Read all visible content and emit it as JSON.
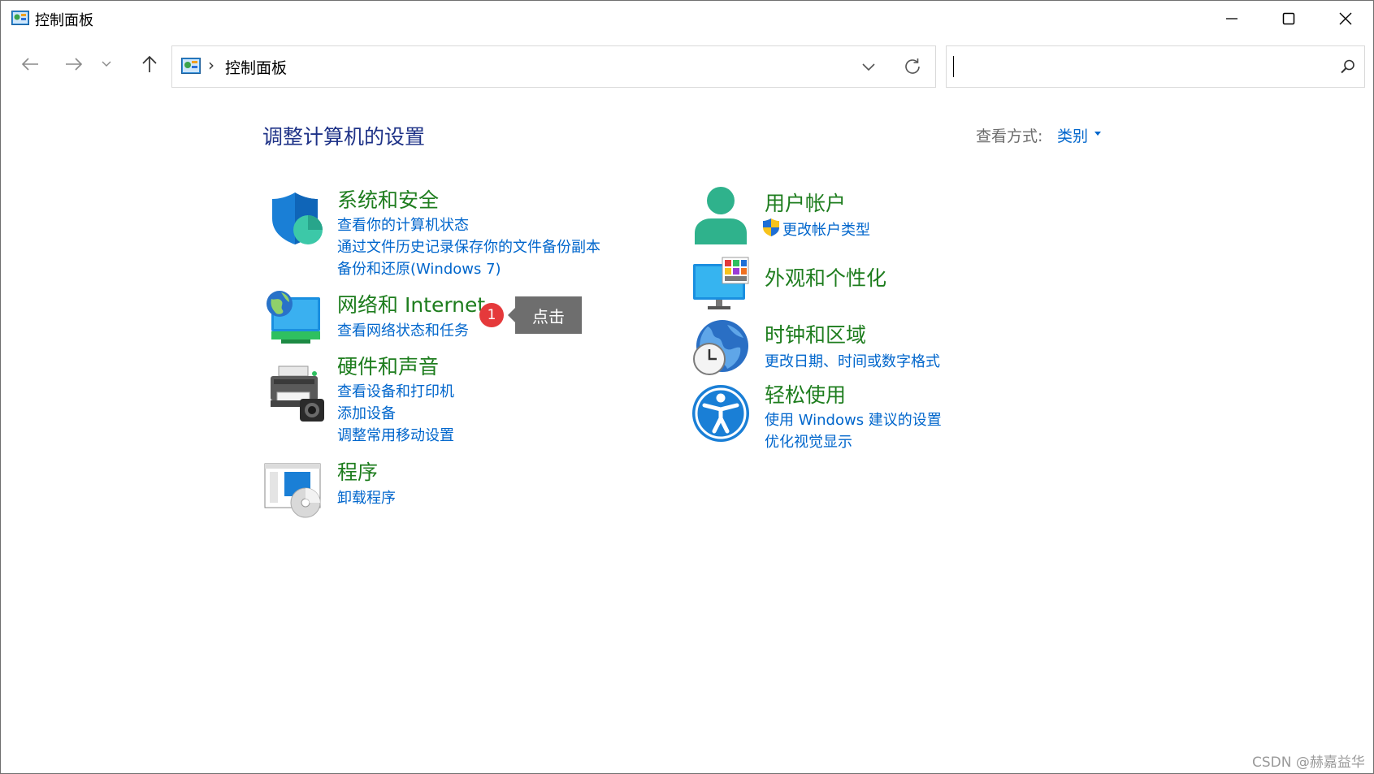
{
  "window": {
    "title": "控制面板",
    "minimize_icon": "minimize-icon",
    "maximize_icon": "maximize-icon",
    "close_icon": "close-icon"
  },
  "nav": {
    "back_icon": "arrow-left-icon",
    "forward_icon": "arrow-right-icon",
    "recent_icon": "chevron-down-icon",
    "up_icon": "arrow-up-icon"
  },
  "address": {
    "separator": "›",
    "path": "控制面板",
    "dropdown_icon": "chevron-down-icon",
    "refresh_icon": "refresh-icon"
  },
  "search": {
    "value": "",
    "icon": "search-icon"
  },
  "main": {
    "title": "调整计算机的设置",
    "view_label": "查看方式:",
    "view_value": "类别"
  },
  "categories": [
    {
      "title": "系统和安全",
      "icon": "shield-icon",
      "links": [
        "查看你的计算机状态",
        "通过文件历史记录保存你的文件备份副本",
        "备份和还原(Windows 7)"
      ]
    },
    {
      "title": "网络和 Internet",
      "icon": "network-globe-icon",
      "links": [
        "查看网络状态和任务"
      ]
    },
    {
      "title": "硬件和声音",
      "icon": "printer-icon",
      "links": [
        "查看设备和打印机",
        "添加设备",
        "调整常用移动设置"
      ]
    },
    {
      "title": "程序",
      "icon": "programs-disc-icon",
      "links": [
        "卸载程序"
      ]
    },
    {
      "title": "用户帐户",
      "icon": "user-icon",
      "links": [
        "更改帐户类型"
      ]
    },
    {
      "title": "外观和个性化",
      "icon": "monitor-palette-icon",
      "links": []
    },
    {
      "title": "时钟和区域",
      "icon": "clock-globe-icon",
      "links": [
        "更改日期、时间或数字格式"
      ]
    },
    {
      "title": "轻松使用",
      "icon": "accessibility-icon",
      "links": [
        "使用 Windows 建议的设置",
        "优化视觉显示"
      ]
    }
  ],
  "annotation": {
    "badge": "1",
    "tooltip": "点击",
    "badge_color": "#e5393b"
  },
  "watermark": "CSDN @赫嘉益华",
  "colors": {
    "category_title": "#1e7d1e",
    "link": "#0066cc",
    "page_title": "#1e3287"
  }
}
